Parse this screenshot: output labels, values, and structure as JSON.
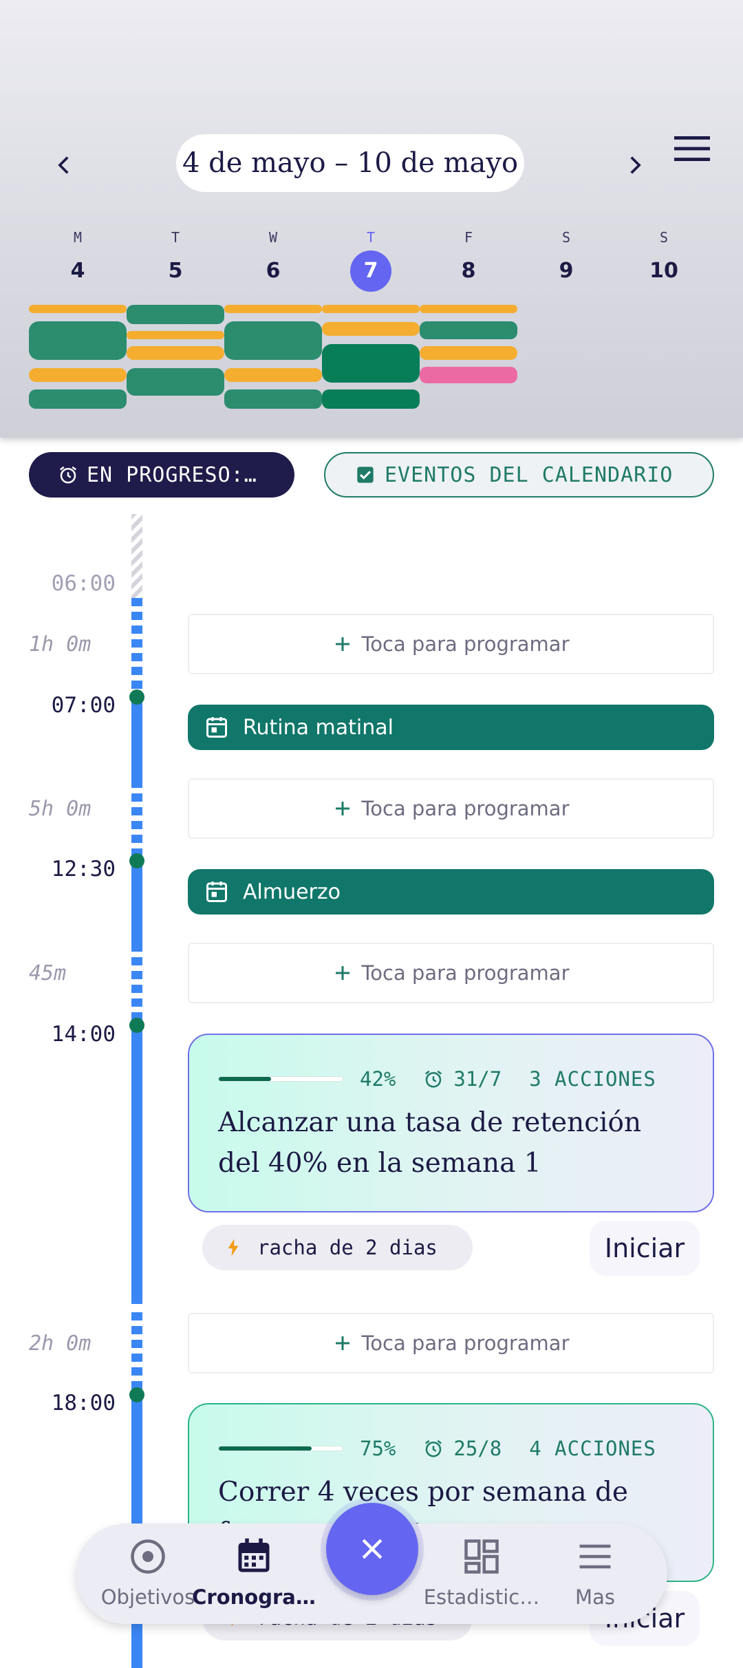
{
  "header": {
    "week_range": "4 de mayo – 10 de mayo",
    "days": [
      {
        "letter": "M",
        "number": "4"
      },
      {
        "letter": "T",
        "number": "5"
      },
      {
        "letter": "W",
        "number": "6"
      },
      {
        "letter": "T",
        "number": "7",
        "today": true
      },
      {
        "letter": "F",
        "number": "8"
      },
      {
        "letter": "S",
        "number": "9"
      },
      {
        "letter": "S",
        "number": "10"
      }
    ]
  },
  "chips": {
    "in_progress": "EN PROGRESO:…",
    "calendar_events": "EVENTOS DEL CALENDARIO"
  },
  "timeline": {
    "times": {
      "t0600": "06:00",
      "t0700": "07:00",
      "t1230": "12:30",
      "t1400": "14:00",
      "t1800": "18:00"
    },
    "durations": {
      "d1": "1h 0m",
      "d2": "5h 0m",
      "d3": "45m",
      "d4": "2h 0m"
    },
    "slot_label": "Toca para programar",
    "events": {
      "morning": "Rutina matinal",
      "lunch": "Almuerzo"
    },
    "goals": [
      {
        "progress": 0.42,
        "percent": "42%",
        "due": "31/7",
        "actions": "3 ACCIONES",
        "title": "Alcanzar una tasa de retención del 40% en la semana 1",
        "streak": "racha de 2 dias",
        "start": "Iniciar"
      },
      {
        "progress": 0.75,
        "percent": "75%",
        "due": "25/8",
        "actions": "4 ACCIONES",
        "title": "Correr 4 veces por semana de forma constante",
        "streak": "racha de 2 dias",
        "start": "Iniciar"
      }
    ]
  },
  "bottom_nav": {
    "goals": "Objetivos",
    "schedule": "Cronogra…",
    "stats": "Estadistic…",
    "more": "Mas"
  },
  "colors": {
    "accent": "#6466f1",
    "navy": "#1f1b4a",
    "teal": "#10776a",
    "timeline_blue": "#3b86f5",
    "bar_yellow": "#f4ad2e",
    "bar_green": "#2b8c6e",
    "bar_dark_green": "#087e58",
    "bar_pink": "#ec6aa4"
  }
}
